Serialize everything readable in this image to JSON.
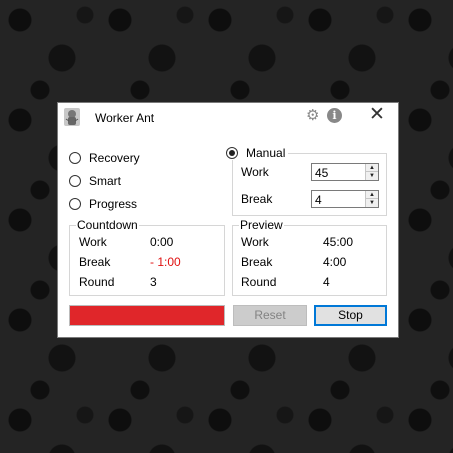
{
  "window": {
    "title": "Worker Ant",
    "icons": {
      "app": "ant-logo-icon",
      "settings": "gear-icon",
      "info": "info-icon",
      "close": "close-icon"
    },
    "close_glyph": "✕",
    "info_glyph": "i",
    "gear_glyph": "⚙"
  },
  "modes": {
    "recovery": "Recovery",
    "smart": "Smart",
    "progress": "Progress",
    "manual": "Manual",
    "selected": "Manual"
  },
  "manual": {
    "work_label": "Work",
    "work_value": "45",
    "break_label": "Break",
    "break_value": "4"
  },
  "countdown": {
    "title": "Countdown",
    "rows": [
      {
        "label": "Work",
        "value": "0:00"
      },
      {
        "label": "Break",
        "value": "- 1:00"
      },
      {
        "label": "Round",
        "value": "3"
      }
    ]
  },
  "preview": {
    "title": "Preview",
    "rows": [
      {
        "label": "Work",
        "value": "45:00"
      },
      {
        "label": "Break",
        "value": "4:00"
      },
      {
        "label": "Round",
        "value": "4"
      }
    ]
  },
  "progress": {
    "fraction": 1.0,
    "color": "#e0262a"
  },
  "buttons": {
    "reset": "Reset",
    "stop": "Stop"
  },
  "colors": {
    "accent": "#0078d7",
    "negative": "#e01010"
  }
}
